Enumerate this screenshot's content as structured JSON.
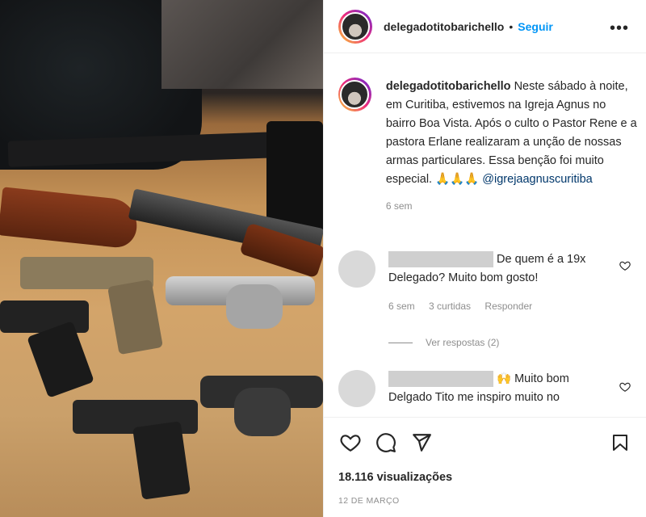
{
  "post": {
    "username": "delegadotitobarichello",
    "follow_label": "Seguir",
    "more_label": "•••",
    "caption_username": "delegadotitobarichello",
    "caption_text": "Neste sábado à noite, em Curitiba, estivemos na Igreja Agnus no bairro Boa Vista. Após o culto o Pastor Rene e a pastora Erlane realizaram a unção de nossas armas particulares. Essa benção foi muito especial. 🙏🙏🙏",
    "caption_mention": "@igrejaagnuscuritiba",
    "caption_time": "6 sem"
  },
  "comments": [
    {
      "text": "De quem é a 19x Delegado? Muito bom gosto!",
      "time": "6 sem",
      "likes": "3 curtidas",
      "reply": "Responder",
      "view_replies": "Ver respostas (2)"
    },
    {
      "text": "🙌 Muito bom Delgado Tito me inspiro muito no"
    }
  ],
  "footer": {
    "views": "18.116 visualizações",
    "date": "12 DE MARÇO"
  },
  "icons": [
    "heart-icon",
    "comment-icon",
    "share-icon",
    "bookmark-icon"
  ],
  "colors": {
    "link": "#0095f6",
    "mention": "#00376b",
    "muted": "#8e8e8e"
  }
}
